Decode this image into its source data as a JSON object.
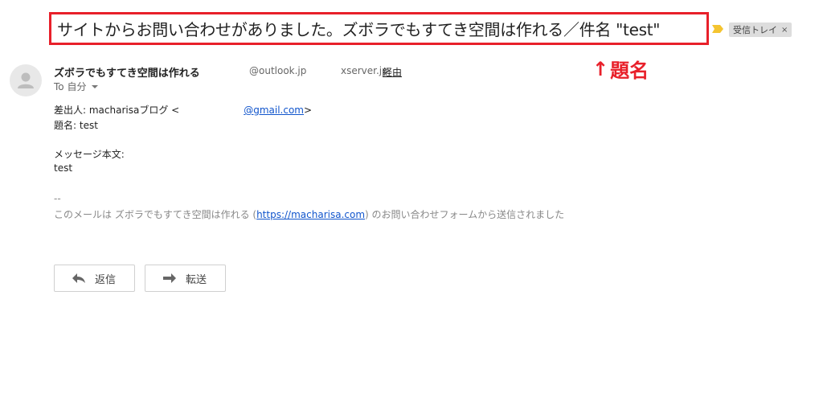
{
  "subject": "サイトからお問い合わせがありました。ズボラでもすてき空間は作れる／件名 \"test\"",
  "label": {
    "name": "受信トレイ",
    "remove": "×"
  },
  "annotation": {
    "arrow": "↑",
    "text": "題名"
  },
  "sender": {
    "name": "ズボラでもすてき空間は作れる",
    "email": "@outlook.jp",
    "via_domain": "xserver.jp",
    "via_label": "経由"
  },
  "to": {
    "label": "To 自分"
  },
  "body": {
    "from_prefix": "差出人: macharisaブログ <",
    "from_email": "@gmail.com",
    "from_suffix": ">",
    "subject_line": "題名: test",
    "message_label": "メッセージ本文:",
    "message": "test",
    "signature_sep": "--",
    "footer_prefix": "このメールは ズボラでもすてき空間は作れる (",
    "footer_link": "https://macharisa.com",
    "footer_suffix": ") のお問い合わせフォームから送信されました"
  },
  "actions": {
    "reply": "返信",
    "forward": "転送"
  },
  "colors": {
    "annotation": "#e8202a",
    "link": "#1155cc",
    "label_bg": "#dddddd"
  }
}
